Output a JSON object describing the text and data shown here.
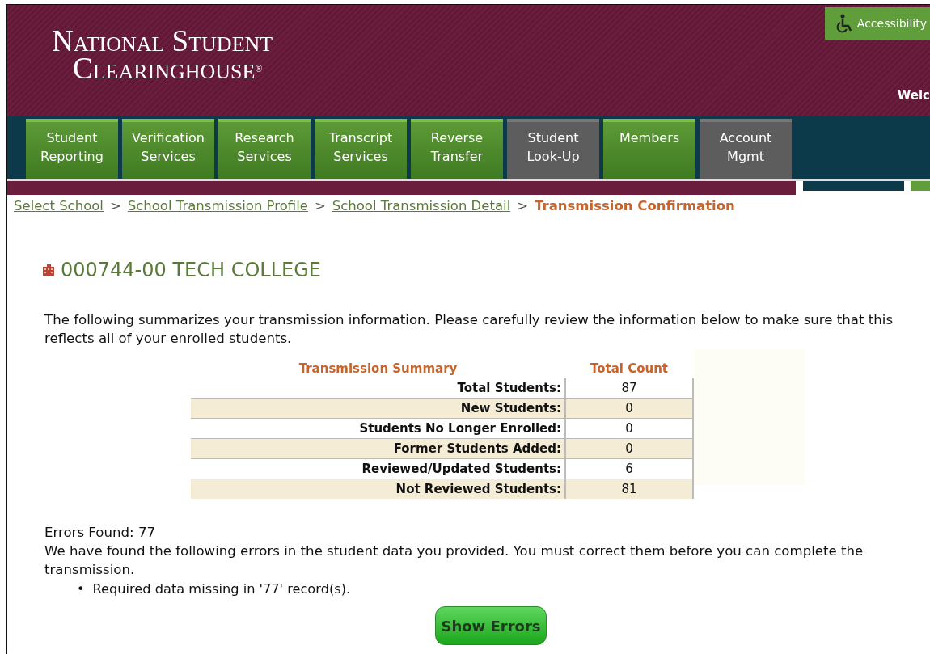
{
  "header": {
    "logo_line_1": "National Student",
    "logo_line_2": "Clearinghouse",
    "logo_mark": "®",
    "accessibility": "Accessibility",
    "welcome": "Welc"
  },
  "nav": [
    {
      "label": "Student Reporting",
      "kind": "primary"
    },
    {
      "label": "Verification Services",
      "kind": "primary"
    },
    {
      "label": "Research Services",
      "kind": "primary"
    },
    {
      "label": "Transcript Services",
      "kind": "primary"
    },
    {
      "label": "Reverse Transfer",
      "kind": "primary"
    },
    {
      "label": "Student Look-Up",
      "kind": "secondary"
    },
    {
      "label": "Members",
      "kind": "primary"
    },
    {
      "label": "Account Mgmt",
      "kind": "secondary"
    }
  ],
  "breadcrumb": [
    {
      "label": "Select School",
      "current": false
    },
    {
      "label": "School Transmission Profile",
      "current": false
    },
    {
      "label": "School Transmission Detail",
      "current": false
    },
    {
      "label": "Transmission Confirmation",
      "current": true
    }
  ],
  "breadcrumb_separator": ">",
  "school_title": "000744-00 TECH COLLEGE",
  "intro": "The following summarizes your transmission information. Please carefully review the information below to make sure that this reflects all of your enrolled students.",
  "summary": {
    "columns": [
      "Transmission Summary",
      "Total Count"
    ],
    "rows": [
      {
        "label": "Total Students:",
        "count": "87"
      },
      {
        "label": "New Students:",
        "count": "0"
      },
      {
        "label": "Students No Longer Enrolled:",
        "count": "0"
      },
      {
        "label": "Former Students Added:",
        "count": "0"
      },
      {
        "label": "Reviewed/Updated Students:",
        "count": "6"
      },
      {
        "label": "Not Reviewed Students:",
        "count": "81"
      }
    ]
  },
  "errors_found": "Errors Found: 77",
  "errors_text": "We have found the following errors in the student data you provided. You must correct them before you can complete the transmission.",
  "error_items": [
    {
      "bullet": "•",
      "text": "Required data missing in '77' record(s)."
    }
  ],
  "show_errors_button": "Show Errors"
}
